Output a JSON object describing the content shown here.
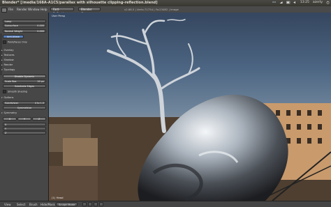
{
  "window": {
    "title": "Blender* [/media/168A-A1C5/parallax with silhouette clipping-reflection.blend]"
  },
  "tray": {
    "time": "13:25",
    "user": "azerty"
  },
  "menu": {
    "items": [
      "File",
      "Render",
      "Window",
      "Help"
    ],
    "layout": "Fast-Reflections",
    "engine": "Blender Game",
    "info": "v2.68.5 | Verts:71754 | Fa:23482 | Image"
  },
  "toolshelf": {
    "fields": [
      {
        "label": "Lamp"
      },
      {
        "label": "Subsurface",
        "value": "0.000"
      },
      {
        "label": "Normal Weight",
        "value": "0.000"
      }
    ],
    "active_button": "Anti-Aliase",
    "checkbox1": "Point/Faces Only",
    "panels": [
      "Overlay",
      "Textures",
      "Shadow",
      "Render",
      "Typology"
    ],
    "disable_dynamics": "Disable Dynamic",
    "scale_label": "Scale Box",
    "scale_value": "20 px",
    "subdivide_edges": "Subdivide Edges",
    "smooth_shading": "Smooth Shading",
    "options_header": "Options",
    "subdivision_label": "Subdivision",
    "subdivision_value": "4 to 1.0",
    "symmetry_label": "Symmetrize",
    "symmetry_header": "Symmetry",
    "xyz": [
      "X",
      "Y",
      "Z"
    ]
  },
  "viewport": {
    "label": "User Persp",
    "object_label": "(1) Head"
  },
  "statusbar": {
    "items": [
      "View",
      "Select",
      "Brush",
      "Hide/Mask"
    ],
    "mode": "Sculpt Mode"
  },
  "colors": {
    "accent": "#5680c2",
    "sky_top": "#35465f",
    "chrome": "#c9cbce"
  }
}
